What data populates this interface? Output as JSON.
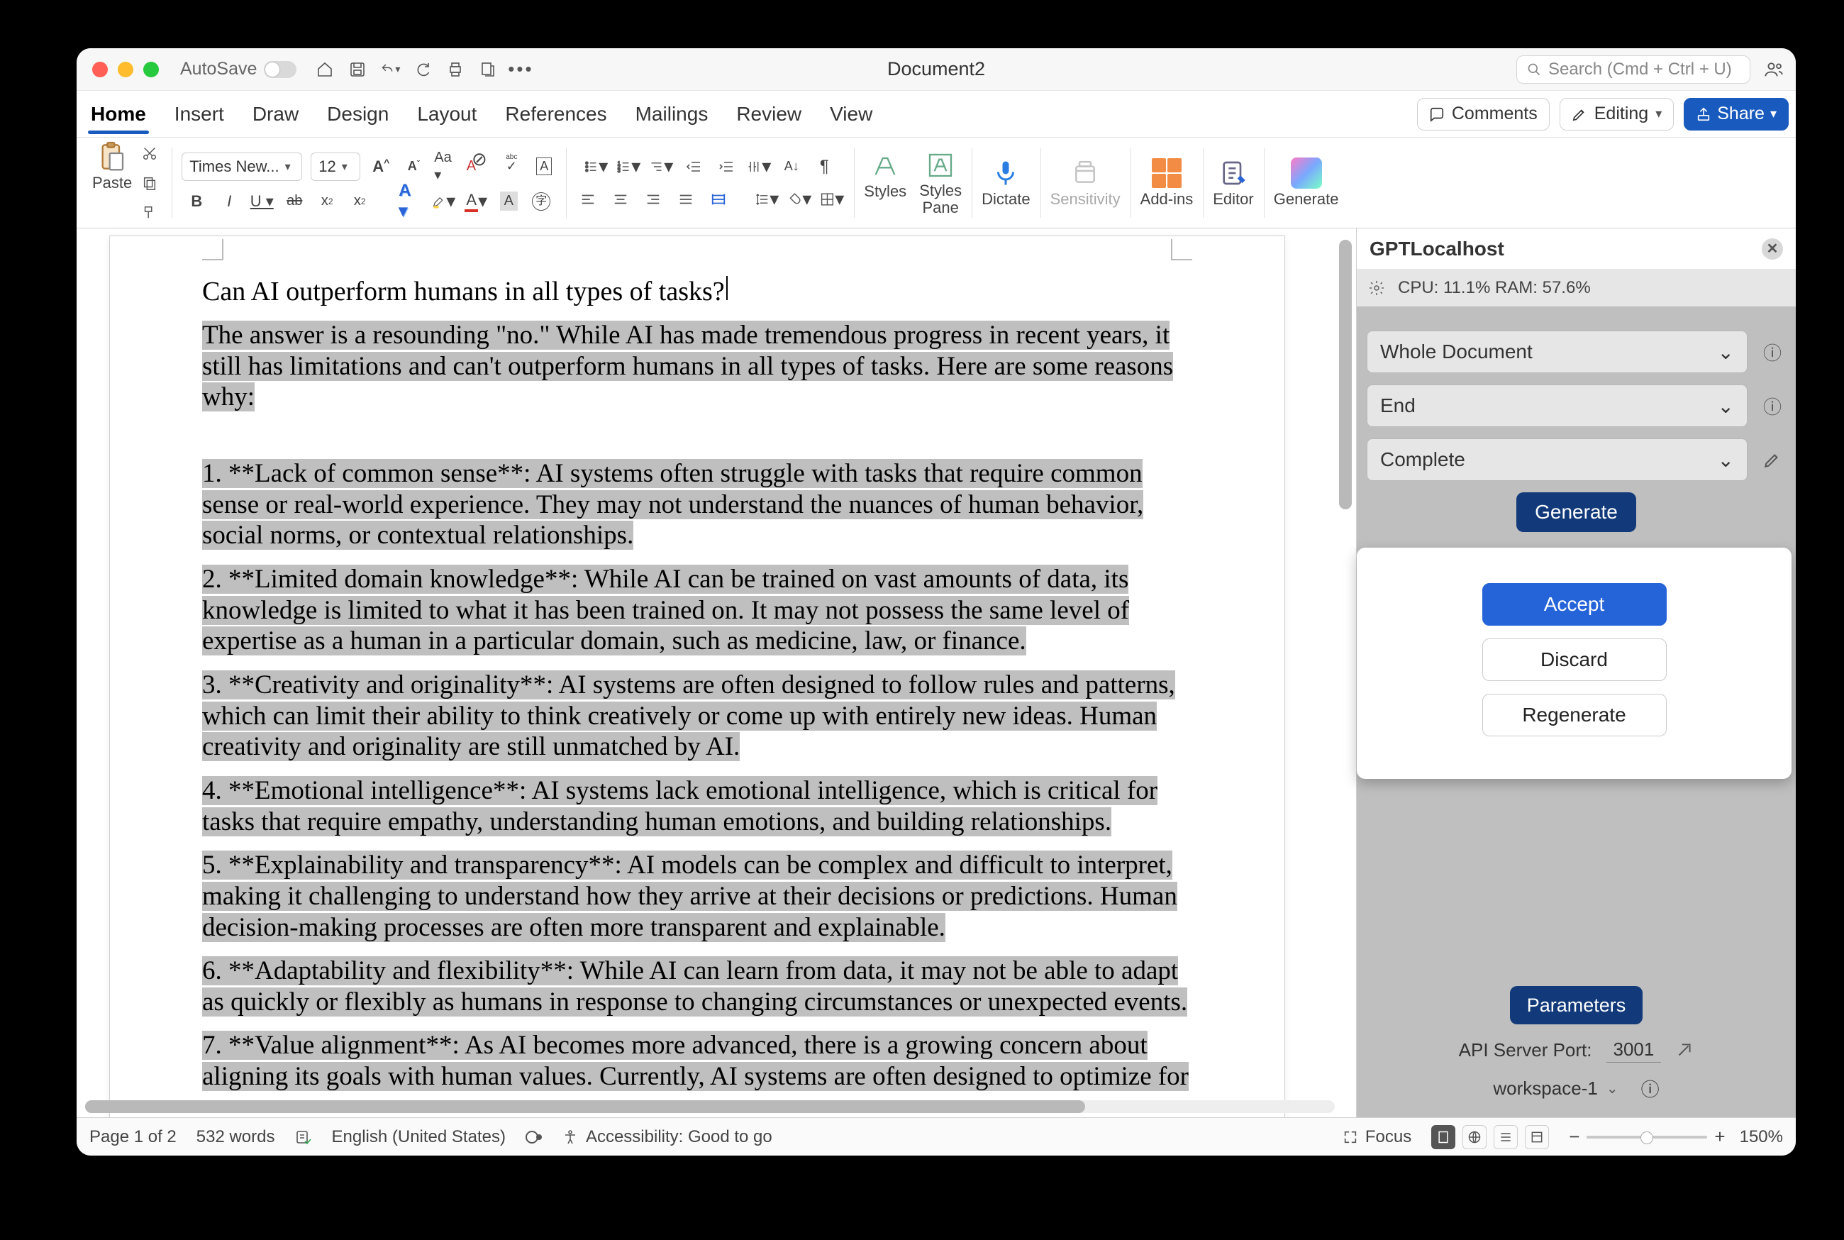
{
  "titlebar": {
    "autosave_label": "AutoSave",
    "doc_title": "Document2",
    "search_placeholder": "Search (Cmd + Ctrl + U)"
  },
  "tabs": {
    "items": [
      "Home",
      "Insert",
      "Draw",
      "Design",
      "Layout",
      "References",
      "Mailings",
      "Review",
      "View"
    ],
    "active_index": 0,
    "comments_label": "Comments",
    "editing_label": "Editing",
    "share_label": "Share"
  },
  "ribbon": {
    "paste_label": "Paste",
    "font_name": "Times New...",
    "font_size": "12",
    "styles_label": "Styles",
    "styles_pane_label": "Styles\nPane",
    "dictate_label": "Dictate",
    "sensitivity_label": "Sensitivity",
    "addins_label": "Add-ins",
    "editor_label": "Editor",
    "generate_label": "Generate"
  },
  "document": {
    "title": "Can AI outperform humans in all types of tasks?",
    "intro": " The answer is a resounding \"no.\" While AI has made tremendous progress in recent years, it still has limitations and can't outperform humans in all types of tasks. Here are some reasons why:",
    "paras": [
      "1. **Lack of common sense**: AI systems often struggle with tasks that require common sense or real-world experience. They may not understand the nuances of human behavior, social norms, or contextual relationships.",
      "2. **Limited domain knowledge**: While AI can be trained on vast amounts of data, its knowledge is limited to what it has been trained on. It may not possess the same level of expertise as a human in a particular domain, such as medicine, law, or finance.",
      "3. **Creativity and originality**: AI systems are often designed to follow rules and patterns, which can limit their ability to think creatively or come up with entirely new ideas. Human creativity and originality are still unmatched by AI.",
      "4. **Emotional intelligence**: AI systems lack emotional intelligence, which is critical for tasks that require empathy, understanding human emotions, and building relationships.",
      "5. **Explainability and transparency**: AI models can be complex and difficult to interpret, making it challenging to understand how they arrive at their decisions or predictions. Human decision-making processes are often more transparent and explainable.",
      "6. **Adaptability and flexibility**: While AI can learn from data, it may not be able to adapt as quickly or flexibly as humans in response to changing circumstances or unexpected events.",
      "7. **Value alignment**: As AI becomes more advanced, there is a growing concern about aligning its goals with human values. Currently, AI systems are often designed to optimize for"
    ]
  },
  "pane": {
    "title": "GPTLocalhost",
    "cpu_label": "CPU: 11.1% RAM: 57.6%",
    "selects": {
      "scope": "Whole Document",
      "position": "End",
      "mode": "Complete"
    },
    "generate_label": "Generate",
    "popup": {
      "accept": "Accept",
      "discard": "Discard",
      "regenerate": "Regenerate"
    },
    "parameters_label": "Parameters",
    "api_port_label": "API Server Port:",
    "api_port_value": "3001",
    "workspace": "workspace-1"
  },
  "status": {
    "page": "Page 1 of 2",
    "words": "532 words",
    "language": "English (United States)",
    "accessibility": "Accessibility: Good to go",
    "focus": "Focus",
    "zoom": "150%"
  }
}
